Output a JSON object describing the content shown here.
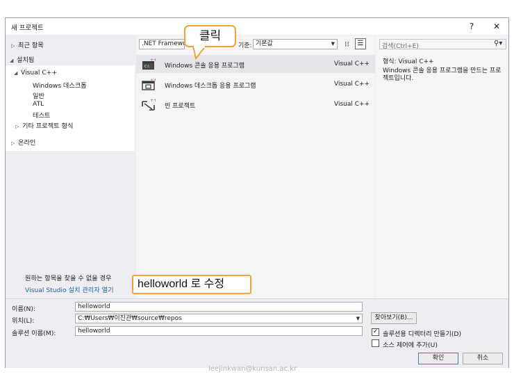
{
  "dialog": {
    "title": "새 프로젝트",
    "help_label": "?",
    "close_label": "✕"
  },
  "tree": {
    "recent": "최근 항목",
    "installed": "설치됨",
    "visual_cpp": "Visual C++",
    "children": [
      "Windows 데스크톱",
      "일반",
      "ATL",
      "테스트"
    ],
    "other": "기타 프로젝트 형식",
    "online": "온라인"
  },
  "help": {
    "text": "원하는 항목을 찾을 수 없을 경우",
    "link": "Visual Studio 설치 관리자 열기"
  },
  "toolbar": {
    "framework": ".NET Framework",
    "sort_label": "기준:",
    "sort_value": "기본값",
    "search_placeholder": "검색(Ctrl+E)"
  },
  "templates": [
    {
      "name": "Windows 콘솔 응용 프로그램",
      "lang": "Visual C++"
    },
    {
      "name": "Windows 데스크톱 응용 프로그램",
      "lang": "Visual C++"
    },
    {
      "name": "빈 프로젝트",
      "lang": "Visual C++"
    }
  ],
  "details": {
    "type_label": "형식:",
    "type_value": "Visual C++",
    "description": "Windows 콘솔 응용 프로그램을 만드는 프로젝트입니다."
  },
  "form": {
    "name_label": "이름(N):",
    "name_value": "helloworld",
    "location_label": "위치(L):",
    "location_value": "C:₩Users₩이진관₩source₩repos",
    "solution_label": "솔루션 이름(M):",
    "solution_value": "helloworld",
    "browse_label": "찾아보기(B)...",
    "create_dir_label": "솔루션용 디렉터리 만들기(D)",
    "create_dir_checked": "✓",
    "source_control_label": "소스 제어에 추가(U)",
    "ok_label": "확인",
    "cancel_label": "취소"
  },
  "annotations": {
    "click": "클릭",
    "rename": "helloworld 로 수정"
  },
  "footer": {
    "watermark": "leejinkwan@kunsan.ac.kr"
  },
  "colors": {
    "callout_border": "#f0a23c",
    "link": "#1e5fb4",
    "icon_purple": "#8a4fb0"
  }
}
